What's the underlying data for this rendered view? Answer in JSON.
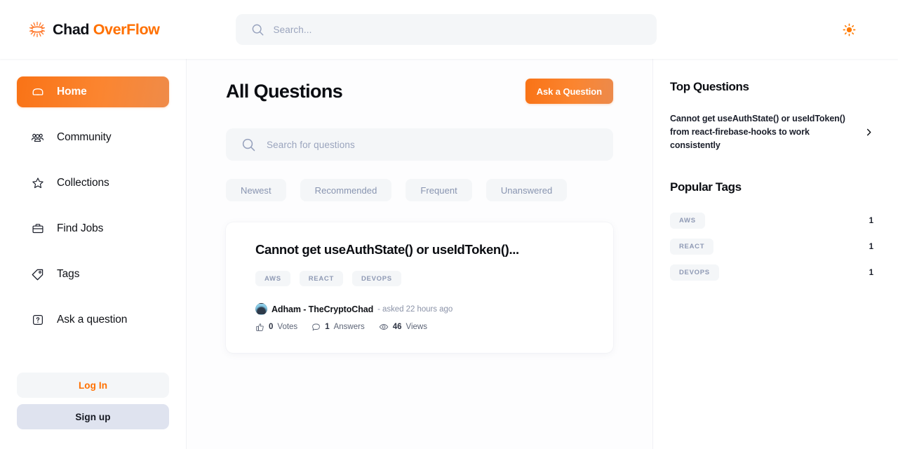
{
  "header": {
    "logo": {
      "icon": "sunburst-logo-icon",
      "text_primary": "Chad",
      "text_accent": "OverFlow"
    },
    "search": {
      "placeholder": "Search...",
      "value": "",
      "icon": "search-icon"
    },
    "theme_toggle": {
      "icon": "sun-icon",
      "mode": "light",
      "color": "#ff7a00"
    }
  },
  "sidebar": {
    "items": [
      {
        "label": "Home",
        "icon": "home-icon",
        "active": true
      },
      {
        "label": "Community",
        "icon": "users-icon",
        "active": false
      },
      {
        "label": "Collections",
        "icon": "star-icon",
        "active": false
      },
      {
        "label": "Find Jobs",
        "icon": "briefcase-icon",
        "active": false
      },
      {
        "label": "Tags",
        "icon": "tag-icon",
        "active": false
      },
      {
        "label": "Ask a question",
        "icon": "question-mark-box-icon",
        "active": false
      }
    ],
    "auth": {
      "login_label": "Log In",
      "signup_label": "Sign up"
    }
  },
  "main": {
    "title": "All Questions",
    "ask_button": "Ask a Question",
    "search": {
      "placeholder": "Search for questions",
      "value": "",
      "icon": "search-icon"
    },
    "filters": [
      "Newest",
      "Recommended",
      "Frequent",
      "Unanswered"
    ],
    "questions": [
      {
        "title": "Cannot get useAuthState() or useIdToken()...",
        "tags": [
          "AWS",
          "REACT",
          "DEVOPS"
        ],
        "author": "Adham - TheCryptoChad",
        "asked": "- asked 22 hours ago",
        "stats": [
          {
            "icon": "thumbs-up-icon",
            "count": "0",
            "label": "Votes"
          },
          {
            "icon": "message-icon",
            "count": "1",
            "label": "Answers"
          },
          {
            "icon": "eye-icon",
            "count": "46",
            "label": "Views"
          }
        ]
      }
    ]
  },
  "right_sidebar": {
    "top_questions_heading": "Top Questions",
    "top_questions": [
      {
        "title": "Cannot get useAuthState() or useIdToken() from react-firebase-hooks to work consistently",
        "chevron": "chevron-right-icon"
      }
    ],
    "popular_tags_heading": "Popular Tags",
    "popular_tags": [
      {
        "name": "AWS",
        "count": "1"
      },
      {
        "name": "REACT",
        "count": "1"
      },
      {
        "name": "DEVOPS",
        "count": "1"
      }
    ]
  },
  "colors": {
    "accent": "#ff7000",
    "accent_gradient_start": "#f97316",
    "accent_gradient_end": "#ef8b49",
    "text_dark": "#0b0d12",
    "muted": "#8e99b4",
    "chip_bg": "#f4f6f8",
    "signup_bg": "#dfe3ef"
  }
}
